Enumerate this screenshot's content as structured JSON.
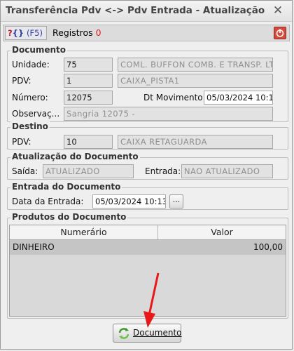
{
  "dialog": {
    "title": "Transferência Pdv <-> Pdv Entrada - Atualização D...",
    "close_glyph": "✕"
  },
  "toolbar": {
    "help_q": "?",
    "help_brackets": "{}",
    "help_key": "(F5)",
    "records_label": "Registros",
    "records_count": "0"
  },
  "documento": {
    "title": "Documento",
    "unidade_label": "Unidade:",
    "unidade_code": "75",
    "unidade_name": "COML. BUFFON COMB. E TRANSP. LTDA",
    "pdv_label": "PDV:",
    "pdv_code": "1",
    "pdv_name": "CAIXA_PISTA1",
    "numero_label": "Número:",
    "numero_value": "12075",
    "dt_label": "Dt Movimento:",
    "dt_value": "05/03/2024 10:1",
    "obs_label": "Observaç...",
    "obs_value": "Sangria 12075 -"
  },
  "destino": {
    "title": "Destino",
    "pdv_label": "PDV:",
    "pdv_code": "10",
    "pdv_name": "CAIXA RETAGUARDA"
  },
  "atualizacao": {
    "title": "Atualização do Documento",
    "saida_label": "Saída:",
    "saida_value": "ATUALIZADO",
    "entrada_label": "Entrada:",
    "entrada_value": "NAO ATUALIZADO"
  },
  "entrada": {
    "title": "Entrada do Documento",
    "data_label": "Data da Entrada:",
    "data_value": "05/03/2024 10:13",
    "picker_label": "..."
  },
  "produtos": {
    "title": "Produtos do Documento",
    "columns": [
      "Numerário",
      "Valor"
    ],
    "rows": [
      {
        "numerario": "DINHEIRO",
        "valor": "100,00"
      }
    ]
  },
  "footer": {
    "documento_button": "Documento"
  },
  "colors": {
    "accent_red": "#e0201c",
    "annotation_arrow": "#e8191a"
  }
}
